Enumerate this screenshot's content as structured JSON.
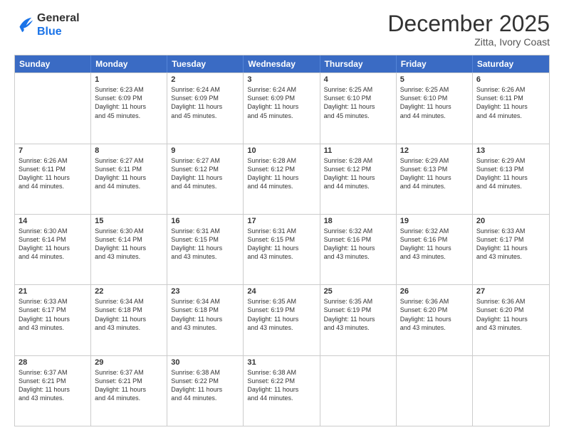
{
  "logo": {
    "line1": "General",
    "line2": "Blue"
  },
  "title": "December 2025",
  "location": "Zitta, Ivory Coast",
  "days_of_week": [
    "Sunday",
    "Monday",
    "Tuesday",
    "Wednesday",
    "Thursday",
    "Friday",
    "Saturday"
  ],
  "weeks": [
    [
      {
        "day": "",
        "info": ""
      },
      {
        "day": "1",
        "info": "Sunrise: 6:23 AM\nSunset: 6:09 PM\nDaylight: 11 hours\nand 45 minutes."
      },
      {
        "day": "2",
        "info": "Sunrise: 6:24 AM\nSunset: 6:09 PM\nDaylight: 11 hours\nand 45 minutes."
      },
      {
        "day": "3",
        "info": "Sunrise: 6:24 AM\nSunset: 6:09 PM\nDaylight: 11 hours\nand 45 minutes."
      },
      {
        "day": "4",
        "info": "Sunrise: 6:25 AM\nSunset: 6:10 PM\nDaylight: 11 hours\nand 45 minutes."
      },
      {
        "day": "5",
        "info": "Sunrise: 6:25 AM\nSunset: 6:10 PM\nDaylight: 11 hours\nand 44 minutes."
      },
      {
        "day": "6",
        "info": "Sunrise: 6:26 AM\nSunset: 6:11 PM\nDaylight: 11 hours\nand 44 minutes."
      }
    ],
    [
      {
        "day": "7",
        "info": "Sunrise: 6:26 AM\nSunset: 6:11 PM\nDaylight: 11 hours\nand 44 minutes."
      },
      {
        "day": "8",
        "info": "Sunrise: 6:27 AM\nSunset: 6:11 PM\nDaylight: 11 hours\nand 44 minutes."
      },
      {
        "day": "9",
        "info": "Sunrise: 6:27 AM\nSunset: 6:12 PM\nDaylight: 11 hours\nand 44 minutes."
      },
      {
        "day": "10",
        "info": "Sunrise: 6:28 AM\nSunset: 6:12 PM\nDaylight: 11 hours\nand 44 minutes."
      },
      {
        "day": "11",
        "info": "Sunrise: 6:28 AM\nSunset: 6:12 PM\nDaylight: 11 hours\nand 44 minutes."
      },
      {
        "day": "12",
        "info": "Sunrise: 6:29 AM\nSunset: 6:13 PM\nDaylight: 11 hours\nand 44 minutes."
      },
      {
        "day": "13",
        "info": "Sunrise: 6:29 AM\nSunset: 6:13 PM\nDaylight: 11 hours\nand 44 minutes."
      }
    ],
    [
      {
        "day": "14",
        "info": "Sunrise: 6:30 AM\nSunset: 6:14 PM\nDaylight: 11 hours\nand 44 minutes."
      },
      {
        "day": "15",
        "info": "Sunrise: 6:30 AM\nSunset: 6:14 PM\nDaylight: 11 hours\nand 43 minutes."
      },
      {
        "day": "16",
        "info": "Sunrise: 6:31 AM\nSunset: 6:15 PM\nDaylight: 11 hours\nand 43 minutes."
      },
      {
        "day": "17",
        "info": "Sunrise: 6:31 AM\nSunset: 6:15 PM\nDaylight: 11 hours\nand 43 minutes."
      },
      {
        "day": "18",
        "info": "Sunrise: 6:32 AM\nSunset: 6:16 PM\nDaylight: 11 hours\nand 43 minutes."
      },
      {
        "day": "19",
        "info": "Sunrise: 6:32 AM\nSunset: 6:16 PM\nDaylight: 11 hours\nand 43 minutes."
      },
      {
        "day": "20",
        "info": "Sunrise: 6:33 AM\nSunset: 6:17 PM\nDaylight: 11 hours\nand 43 minutes."
      }
    ],
    [
      {
        "day": "21",
        "info": "Sunrise: 6:33 AM\nSunset: 6:17 PM\nDaylight: 11 hours\nand 43 minutes."
      },
      {
        "day": "22",
        "info": "Sunrise: 6:34 AM\nSunset: 6:18 PM\nDaylight: 11 hours\nand 43 minutes."
      },
      {
        "day": "23",
        "info": "Sunrise: 6:34 AM\nSunset: 6:18 PM\nDaylight: 11 hours\nand 43 minutes."
      },
      {
        "day": "24",
        "info": "Sunrise: 6:35 AM\nSunset: 6:19 PM\nDaylight: 11 hours\nand 43 minutes."
      },
      {
        "day": "25",
        "info": "Sunrise: 6:35 AM\nSunset: 6:19 PM\nDaylight: 11 hours\nand 43 minutes."
      },
      {
        "day": "26",
        "info": "Sunrise: 6:36 AM\nSunset: 6:20 PM\nDaylight: 11 hours\nand 43 minutes."
      },
      {
        "day": "27",
        "info": "Sunrise: 6:36 AM\nSunset: 6:20 PM\nDaylight: 11 hours\nand 43 minutes."
      }
    ],
    [
      {
        "day": "28",
        "info": "Sunrise: 6:37 AM\nSunset: 6:21 PM\nDaylight: 11 hours\nand 43 minutes."
      },
      {
        "day": "29",
        "info": "Sunrise: 6:37 AM\nSunset: 6:21 PM\nDaylight: 11 hours\nand 44 minutes."
      },
      {
        "day": "30",
        "info": "Sunrise: 6:38 AM\nSunset: 6:22 PM\nDaylight: 11 hours\nand 44 minutes."
      },
      {
        "day": "31",
        "info": "Sunrise: 6:38 AM\nSunset: 6:22 PM\nDaylight: 11 hours\nand 44 minutes."
      },
      {
        "day": "",
        "info": ""
      },
      {
        "day": "",
        "info": ""
      },
      {
        "day": "",
        "info": ""
      }
    ]
  ]
}
